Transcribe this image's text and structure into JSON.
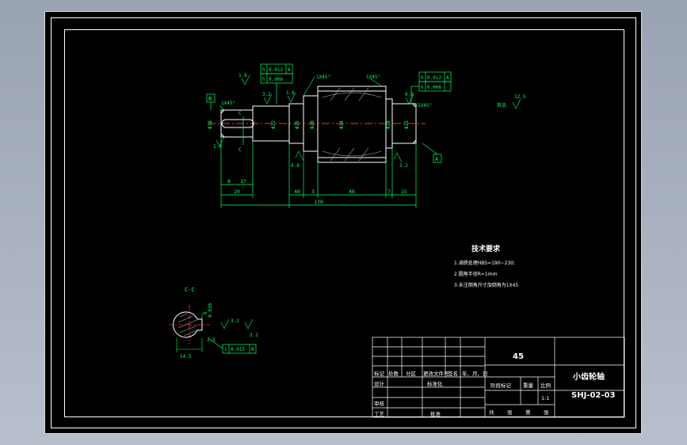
{
  "colors": {
    "background": "#000000",
    "outline": "#ffffff",
    "centerline": "#ff3030",
    "dimension": "#00ff66",
    "hatch": "#b0b0b0",
    "frame_bg": "#9aa3b3"
  },
  "main_view": {
    "chamfer_labels": [
      "1X45°",
      "1X45°",
      "1X45°",
      "1X45°"
    ],
    "roughness_labels": [
      "1.6",
      "3.2",
      "1.6",
      "0.8",
      "0.8",
      "3.2",
      "1.6",
      "0.8",
      "1.6",
      "1.6",
      "0.8"
    ],
    "datum_labels": [
      "B",
      "A"
    ],
    "section_marks": [
      "C",
      "C"
    ],
    "geometric_tolerances": [
      {
        "symbol": "h",
        "value": "0.012",
        "datum": "A"
      },
      {
        "symbol": "h",
        "value": "0.006",
        "datum": ""
      },
      {
        "symbol": "h",
        "value": "0.012",
        "datum": "A"
      },
      {
        "symbol": "h",
        "value": "0.006",
        "datum": ""
      }
    ],
    "length_dims": [
      "8",
      "17",
      "20",
      "40",
      "3",
      "46",
      "7",
      "15",
      "138"
    ],
    "diameter_dims": [
      "Φ18",
      "Φ22",
      "Φ25",
      "Φ28",
      "Φ34",
      "Φ28",
      "Φ25"
    ],
    "roughness_other": "12.5",
    "roughness_other_note": "其余"
  },
  "section_view": {
    "title": "C-C",
    "dims": [
      "6",
      "0.036",
      "14.5",
      "2.5",
      "0.015"
    ],
    "roughness_labels": [
      "3.2",
      "3.2"
    ],
    "tolerance": {
      "symbol": "i",
      "value": "0.015",
      "datum": "B"
    }
  },
  "tech_requirements": {
    "title": "技术要求",
    "lines": [
      "1.调质处理HBS=190~230;",
      "2.圆角半径R=1mm",
      "3.未注倒角尺寸加倒角为1X45"
    ]
  },
  "title_block": {
    "material": "45",
    "part_name": "小齿轮轴",
    "drawing_no": "SHJ-02-03",
    "scale_value": "1:1",
    "row_labels": [
      "标记",
      "处数",
      "分区",
      "更改文件号",
      "签名",
      "年、月、日"
    ],
    "design_label": "设计",
    "standardize_label": "标准化",
    "review_label": "审核",
    "process_label": "工艺",
    "approve_label": "批准",
    "stage_label": "阶段标记",
    "weight_label": "重量",
    "scale_label": "比例",
    "sheet_labels": [
      "共",
      "张",
      "第",
      "张"
    ]
  }
}
